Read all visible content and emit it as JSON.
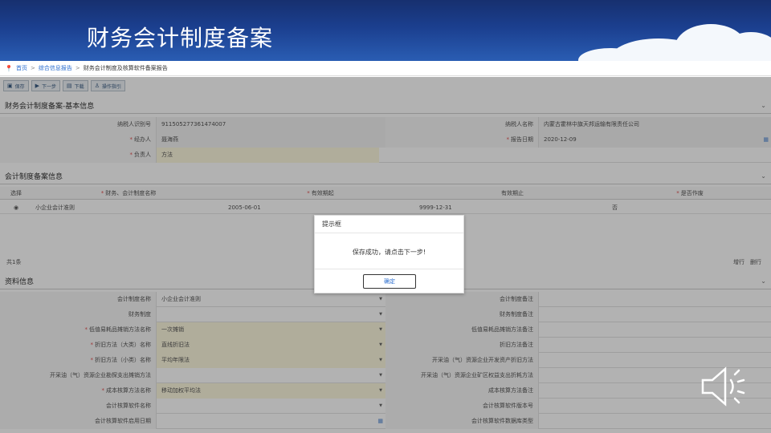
{
  "slide": {
    "title": "财务会计制度备案"
  },
  "breadcrumb": {
    "home": "首页",
    "sep": ">",
    "level2": "综合信息报告",
    "current": "财务会计制度及核算软件备案报告"
  },
  "toolbar": {
    "items": [
      {
        "icon": "save-icon",
        "label": "保存"
      },
      {
        "icon": "next-icon",
        "label": "下一步"
      },
      {
        "icon": "download-icon",
        "label": "下载"
      },
      {
        "icon": "guide-icon",
        "label": "操作指引"
      }
    ]
  },
  "basic": {
    "title": "财务会计制度备案-基本信息",
    "taxpayer_id_label": "纳税人识别号",
    "taxpayer_id_value": "911505277361474007",
    "taxpayer_name_label": "纳税人名称",
    "taxpayer_name_value": "内蒙古霍林中旗天邦运输有限责任公司",
    "handler_label": "经办人",
    "handler_value": "聂海燕",
    "report_date_label": "报告日期",
    "report_date_value": "2020-12-09",
    "principal_label": "负责人",
    "principal_value": "方法"
  },
  "filing": {
    "title": "会计制度备案信息",
    "columns": [
      "选择",
      "财务、会计制度名称",
      "有效期起",
      "有效期止",
      "是否作废"
    ],
    "row": {
      "name": "小企业会计准则",
      "start": "2005-06-01",
      "end": "9999-12-31",
      "void": "否"
    },
    "count": "共1条",
    "add": "增行",
    "delete": "删行"
  },
  "materials": {
    "title": "资料信息",
    "left": [
      {
        "label": "会计制度名称",
        "value": "小企业会计准则",
        "req": false,
        "style": "white"
      },
      {
        "label": "财务制度",
        "value": "",
        "req": false,
        "style": "white"
      },
      {
        "label": "低值易耗品摊销方法名称",
        "value": "一次摊销",
        "req": true,
        "style": "yellow"
      },
      {
        "label": "折旧方法（大类）名称",
        "value": "直线折旧法",
        "req": true,
        "style": "yellow"
      },
      {
        "label": "折旧方法（小类）名称",
        "value": "平均年限法",
        "req": true,
        "style": "yellow"
      },
      {
        "label": "开采油（气）资源企业勘探支出摊销方法",
        "value": "",
        "req": false,
        "style": "white"
      },
      {
        "label": "成本核算方法名称",
        "value": "移动加权平均法",
        "req": true,
        "style": "yellow"
      },
      {
        "label": "会计核算软件名称",
        "value": "",
        "req": false,
        "style": "white"
      },
      {
        "label": "会计核算软件启用日期",
        "value": "",
        "req": false,
        "style": "white"
      }
    ],
    "right": [
      {
        "label": "会计制度备注",
        "value": ""
      },
      {
        "label": "财务制度备注",
        "value": ""
      },
      {
        "label": "低值易耗品摊销方法备注",
        "value": ""
      },
      {
        "label": "折旧方法备注",
        "value": ""
      },
      {
        "label": "开采油（气）资源企业开发资产折旧方法",
        "value": ""
      },
      {
        "label": "开采油（气）资源企业矿区权益支出折耗方法",
        "value": ""
      },
      {
        "label": "成本核算方法备注",
        "value": ""
      },
      {
        "label": "会计核算软件版本号",
        "value": ""
      },
      {
        "label": "会计核算软件数据库类型",
        "value": ""
      }
    ]
  },
  "dialog": {
    "title": "提示框",
    "message": "保存成功，请点击下一步!",
    "ok": "确定"
  },
  "colors": {
    "banner": "#1b3f8f",
    "link": "#2b6ecf",
    "required": "#e05050",
    "yellow_field": "#fdf8df"
  }
}
